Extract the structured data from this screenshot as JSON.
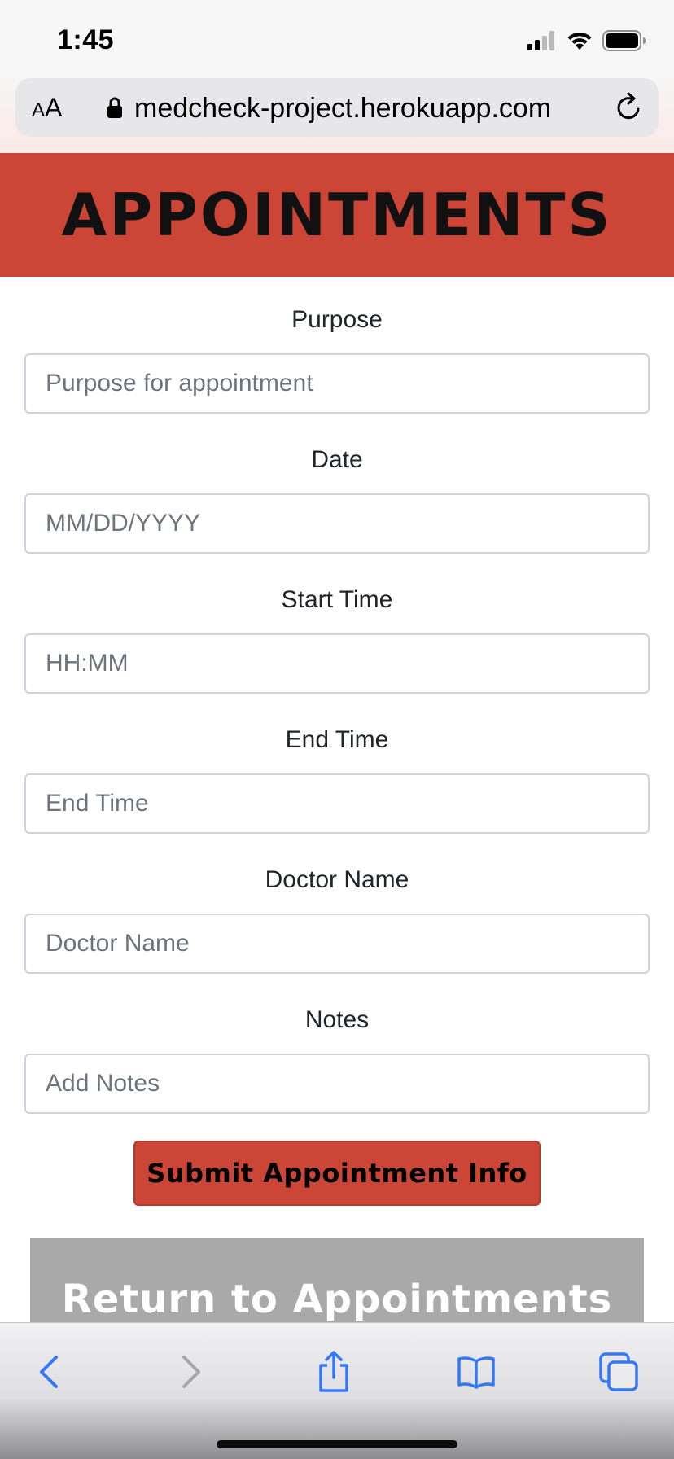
{
  "status_bar": {
    "time": "1:45",
    "icons": [
      "cellular-signal-icon",
      "wifi-icon",
      "battery-icon"
    ]
  },
  "browser": {
    "text_size_button": {
      "small": "A",
      "big": "A"
    },
    "url": "medcheck-project.herokuapp.com",
    "lock_icon": "lock-icon",
    "reload_icon": "reload-icon"
  },
  "page": {
    "title": "APPOINTMENTS",
    "header_color": "#cb4637"
  },
  "form": {
    "fields": [
      {
        "label": "Purpose",
        "placeholder": "Purpose for appointment",
        "value": ""
      },
      {
        "label": "Date",
        "placeholder": "MM/DD/YYYY",
        "value": ""
      },
      {
        "label": "Start Time",
        "placeholder": "HH:MM",
        "value": ""
      },
      {
        "label": "End Time",
        "placeholder": "End Time",
        "value": ""
      },
      {
        "label": "Doctor Name",
        "placeholder": "Doctor Name",
        "value": ""
      },
      {
        "label": "Notes",
        "placeholder": "Add Notes",
        "value": ""
      }
    ],
    "submit_label": "Submit Appointment Info",
    "return_label": "Return to Appointments"
  },
  "toolbar": {
    "items": [
      "back-icon",
      "forward-icon",
      "share-icon",
      "bookmarks-icon",
      "tabs-icon"
    ],
    "accent_color": "#3478f6",
    "disabled_color": "#a6a6aa"
  }
}
